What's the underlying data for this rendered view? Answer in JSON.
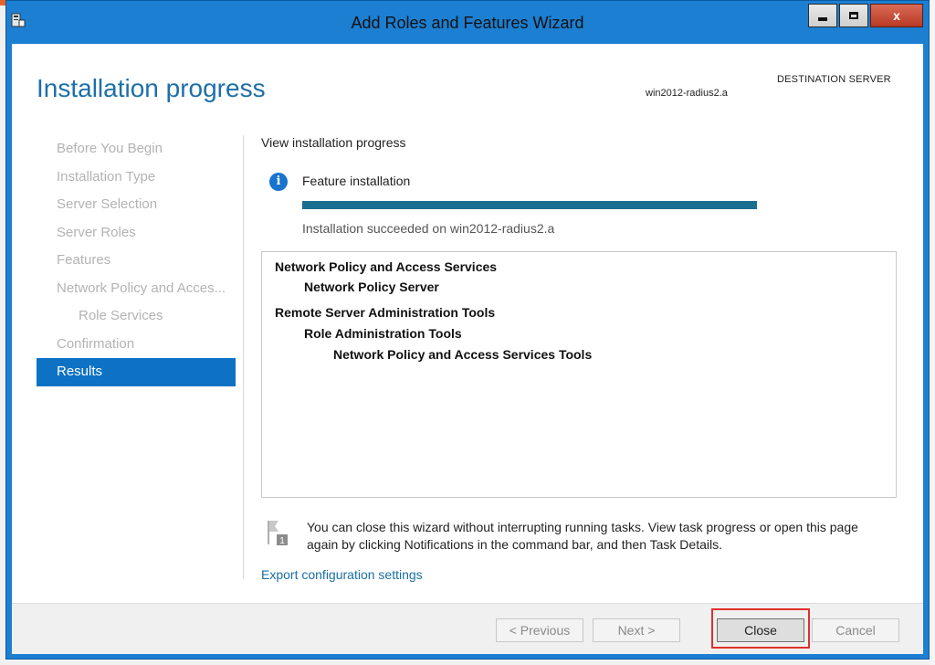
{
  "window": {
    "title": "Add Roles and Features Wizard",
    "close_glyph": "x",
    "icons": {
      "app": "server-manager-icon",
      "minimize": "minimize-icon",
      "maximize": "maximize-icon",
      "close": "close-icon"
    },
    "accent_color": "#1c7fd2"
  },
  "header": {
    "page_title": "Installation progress",
    "destination_label": "DESTINATION SERVER",
    "destination_value": "win2012-radius2.a"
  },
  "nav": {
    "items": [
      {
        "label": "Before You Begin",
        "state": "disabled"
      },
      {
        "label": "Installation Type",
        "state": "disabled"
      },
      {
        "label": "Server Selection",
        "state": "disabled"
      },
      {
        "label": "Server Roles",
        "state": "disabled"
      },
      {
        "label": "Features",
        "state": "disabled"
      },
      {
        "label": "Network Policy and Acces...",
        "state": "disabled"
      },
      {
        "label": "Role Services",
        "state": "disabled"
      },
      {
        "label": "Confirmation",
        "state": "disabled"
      },
      {
        "label": "Results",
        "state": "active"
      }
    ],
    "active_color": "#0e72c4"
  },
  "content": {
    "section_label": "View installation progress",
    "feature_label": "Feature installation",
    "info_glyph": "i",
    "progress": 1.0,
    "status": "Installation succeeded on win2012-radius2.a",
    "results": [
      "Network Policy and Access Services",
      "Network Policy Server",
      "Remote Server Administration Tools",
      "Role Administration Tools",
      "Network Policy and Access Services Tools"
    ],
    "notice_badge": "1",
    "notice": "You can close this wizard without interrupting running tasks. View task progress or open this page again by clicking Notifications in the command bar, and then Task Details.",
    "export_link": "Export configuration settings"
  },
  "footer": {
    "previous": "< Previous",
    "next": "Next >",
    "close": "Close",
    "cancel": "Cancel",
    "highlight_color": "#e0302a"
  }
}
